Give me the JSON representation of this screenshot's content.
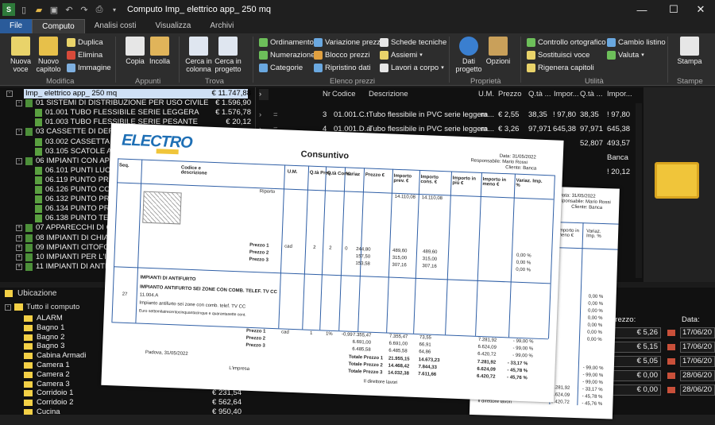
{
  "titlebar": {
    "title": "Computo Imp_ elettrico app_ 250 mq",
    "min": "—",
    "max": "☐",
    "close": "✕"
  },
  "menu": {
    "file": "File",
    "tabs": [
      "Computo",
      "Analisi costi",
      "Visualizza",
      "Archivi"
    ]
  },
  "ribbon": {
    "modifica": {
      "label": "Modifica",
      "nuova_voce": "Nuova voce",
      "nuovo_capitolo": "Nuovo capitolo",
      "duplica": "Duplica",
      "elimina": "Elimina",
      "immagine": "Immagine"
    },
    "appunti": {
      "label": "Appunti",
      "copia": "Copia",
      "incolla": "Incolla"
    },
    "trova": {
      "label": "Trova",
      "cerca_colonna": "Cerca in colonna",
      "cerca_progetto": "Cerca in progetto"
    },
    "elenco": {
      "label": "Elenco prezzi",
      "ordinamento": "Ordinamento",
      "numerazione": "Numerazione",
      "categorie": "Categorie",
      "variazione": "Variazione prezzi",
      "blocco": "Blocco prezzi",
      "ripristino": "Ripristino dati",
      "schede": "Schede tecniche",
      "assiemi": "Assiemi",
      "lavori": "Lavori a corpo"
    },
    "proprieta": {
      "label": "Proprietà",
      "dati_progetto": "Dati progetto",
      "opzioni": "Opzioni"
    },
    "utilita": {
      "label": "Utilità",
      "controllo": "Controllo ortografico",
      "sostituisci": "Sostituisci voce",
      "rigenera": "Rigenera capitoli",
      "cambio": "Cambio listino",
      "valuta": "Valuta"
    },
    "stampe": {
      "label": "Stampe",
      "stampa": "Stampa"
    }
  },
  "tree": [
    {
      "indent": 0,
      "exp": "-",
      "doc": false,
      "text": "Imp_ elettrico app_ 250 mq",
      "amount": "€ 11.747,88",
      "sel": true
    },
    {
      "indent": 1,
      "exp": "-",
      "doc": false,
      "text": "01  SISTEMI DI DISTRIBUZIONE PER USO CIVILE",
      "amount": "€ 1.596,90"
    },
    {
      "indent": 2,
      "exp": "",
      "doc": true,
      "text": "01.001  TUBO FLESSIBILE SERIE LEGGERA",
      "amount": "€ 1.576,78"
    },
    {
      "indent": 2,
      "exp": "",
      "doc": true,
      "text": "01.003  TUBO FLESSIBILE SERIE PESANTE",
      "amount": "€ 20,12"
    },
    {
      "indent": 1,
      "exp": "-",
      "doc": false,
      "text": "03  CASSETTE DI DERIV.C",
      "amount": ""
    },
    {
      "indent": 2,
      "exp": "",
      "doc": true,
      "text": "03.002  CASSETTA DI",
      "amount": ""
    },
    {
      "indent": 2,
      "exp": "",
      "doc": true,
      "text": "03.105  SCATOLE A IN",
      "amount": ""
    },
    {
      "indent": 1,
      "exp": "-",
      "doc": false,
      "text": "06  IMPIANTI CON APPAR",
      "amount": ""
    },
    {
      "indent": 2,
      "exp": "",
      "doc": true,
      "text": "06.101  PUNTI LUCE P",
      "amount": ""
    },
    {
      "indent": 2,
      "exp": "",
      "doc": true,
      "text": "06.119  PUNTO PRESA",
      "amount": ""
    },
    {
      "indent": 2,
      "exp": "",
      "doc": true,
      "text": "06.126  PUNTO CON N",
      "amount": ""
    },
    {
      "indent": 2,
      "exp": "",
      "doc": true,
      "text": "06.132  PUNTO PRESA",
      "amount": ""
    },
    {
      "indent": 2,
      "exp": "",
      "doc": true,
      "text": "06.134  PUNTO PRESA",
      "amount": ""
    },
    {
      "indent": 2,
      "exp": "",
      "doc": true,
      "text": "06.138  PUNTO TERM",
      "amount": ""
    },
    {
      "indent": 1,
      "exp": "+",
      "doc": false,
      "text": "07  APPARECCHI DI COM",
      "amount": ""
    },
    {
      "indent": 1,
      "exp": "+",
      "doc": false,
      "text": "08  IMPIANTI DI CHIAMA",
      "amount": ""
    },
    {
      "indent": 1,
      "exp": "+",
      "doc": false,
      "text": "09  IMPIANTI CITOFONIC",
      "amount": ""
    },
    {
      "indent": 1,
      "exp": "+",
      "doc": false,
      "text": "10  IMPIANTI PER L'ILLUM",
      "amount": ""
    },
    {
      "indent": 1,
      "exp": "+",
      "doc": false,
      "text": "11  IMPIANTI DI ANTIFURT",
      "amount": ""
    }
  ],
  "grid": {
    "headers": [
      "Nr",
      "Codice",
      "Descrizione",
      "U.M.",
      "Prezzo",
      "Q.tà ...",
      "Impor...",
      "Q.tà ...",
      "Impor..."
    ],
    "rows": [
      {
        "nr": "3",
        "code": "01.001.C.t",
        "desc": "Tubo flessibile in PVC serie leggera...",
        "um": "m",
        "price": "€ 2,55",
        "q1": "38,35",
        "i1": "! 97,80",
        "q2": "38,35",
        "i2": "! 97,80"
      },
      {
        "nr": "4",
        "code": "01.001.D.a",
        "desc": "Tubo flessibile in PVC serie leggera...",
        "um": "m",
        "price": "€ 3,26",
        "q1": "97,971",
        "i1": "645,38",
        "q2": "97,971",
        "i2": "645,38"
      },
      {
        "nr": "",
        "code": "",
        "desc": "",
        "um": "",
        "price": "",
        "q1": "52,807",
        "i1": "",
        "q2": "52,807",
        "i2": "493,57"
      },
      {
        "nr": "",
        "code": "",
        "desc": "",
        "um": "",
        "price": "",
        "q1": "",
        "i1": "",
        "q2": "",
        "i2": "Banca"
      },
      {
        "nr": "",
        "code": "",
        "desc": "",
        "um": "",
        "price": "",
        "q1": "4,573",
        "i1": "",
        "q2": "",
        "i2": "! 20,12"
      }
    ]
  },
  "ubicazione": {
    "title": "Ubicazione",
    "root": "Tutto il computo",
    "items": [
      {
        "name": "ALARM",
        "amount": ""
      },
      {
        "name": "Bagno 1",
        "amount": ""
      },
      {
        "name": "Bagno 2",
        "amount": ""
      },
      {
        "name": "Bagno 3",
        "amount": ""
      },
      {
        "name": "Cabina Armadi",
        "amount": ""
      },
      {
        "name": "Camera 1",
        "amount": ""
      },
      {
        "name": "Camera 2",
        "amount": ""
      },
      {
        "name": "Camera 3",
        "amount": ""
      },
      {
        "name": "Corridoio 1",
        "amount": "€ 231,54"
      },
      {
        "name": "Corridoio 2",
        "amount": "€ 562,64"
      },
      {
        "name": "Cucina",
        "amount": "€ 950,40"
      }
    ]
  },
  "prices": {
    "prezzo_label": "Prezzo:",
    "data_label": "Data:",
    "rows": [
      {
        "price": "€ 5,26",
        "date": "17/06/20"
      },
      {
        "price": "€ 5,15",
        "date": "17/06/20"
      },
      {
        "price": "€ 5,05",
        "date": "17/06/20"
      },
      {
        "price": "€ 0,00",
        "date": "28/06/20"
      },
      {
        "price": "€ 0,00",
        "date": "28/06/20"
      }
    ]
  },
  "report": {
    "logo": "ELECTRO",
    "title": "Consuntivo",
    "date": "Data: 31/05/2022",
    "resp": "Responsabile: Mario Rossi",
    "client": "Cliente: Banca",
    "cols": [
      "Seq.",
      "Codice e descrizione",
      "U.M.",
      "Q.tà Prev.",
      "Q.tà Cons.",
      "Variaz",
      "Prezzo €",
      "Importo prev. €",
      "Importo cons. €",
      "Importo in più €",
      "Importo in meno €",
      "Variaz. Imp. %"
    ],
    "riporto": "Riporto",
    "riporto_prev": "14.110,08",
    "riporto_cons": "14.110,08",
    "block1": {
      "labels": [
        "Prezzo 1",
        "Prezzo 2",
        "Prezzo 3"
      ],
      "um": "cad",
      "qp": "2",
      "qc": "2",
      "var": "0",
      "prices": [
        "244,80",
        "157,50",
        "153,58"
      ],
      "prev": [
        "489,60",
        "315,00",
        "307,16"
      ],
      "cons": [
        "489,60",
        "315,00",
        "307,16"
      ],
      "pct": [
        "0,00 %",
        "0,00 %",
        "0,00 %"
      ]
    },
    "item_title": "IMPIANTI DI ANTIFURTO",
    "item_sub": "IMPIANTO ANTIFURTO SEI ZONE CON COMB. TELEF. TV CC",
    "seq": "27",
    "code": "11.004.A",
    "desc1": "Impianto antifurto sei zone con comb. telef. TV CC",
    "desc2": "Euro settemilatrecentocinquantacinque e quarantasette cent.",
    "block2": {
      "labels": [
        "Prezzo 1",
        "Prezzo 2",
        "Prezzo 3"
      ],
      "um": "cad",
      "qp": "1",
      "qc": "1%",
      "var": "-0,99",
      "prices": [
        "7.355,47",
        "6.691,00",
        "6.485,58"
      ],
      "prev": [
        "7.355,47",
        "6.691,00",
        "6.485,58"
      ],
      "cons": [
        "73,55",
        "66,91",
        "64,86"
      ],
      "meno": [
        "7.281,92",
        "6.624,09",
        "6.420,72"
      ],
      "pct": [
        "- 99,00 %",
        "- 99,00 %",
        "- 99,00 %"
      ]
    },
    "totals": [
      {
        "label": "Totale Prezzo 1",
        "prev": "21.955,15",
        "cons": "14.673,23",
        "meno": "7.281,92",
        "pct": "- 33,17 %"
      },
      {
        "label": "Totale Prezzo 2",
        "prev": "14.468,42",
        "cons": "7.844,33",
        "meno": "6.624,09",
        "pct": "- 45,78 %"
      },
      {
        "label": "Totale Prezzo 3",
        "prev": "14.032,38",
        "cons": "7.611,66",
        "meno": "6.420,72",
        "pct": "- 45,76 %"
      }
    ],
    "place": "Padova, 31/05/2022",
    "impresa": "L'impresa",
    "direttore": "Il direttore lavori"
  },
  "report2": {
    "date": "Data: 31/05/2022",
    "resp": "Responsabile: Mario Rossi",
    "client": "Cliente: Banca",
    "cols": [
      "Importo in meno €",
      "Variaz. Imp. %"
    ],
    "pcts": [
      "0,00 %",
      "0,00 %",
      "0,00 %",
      "0,00 %",
      "0,00 %",
      "0,00 %",
      "0,00 %"
    ],
    "bottom": [
      "- 99,00 %",
      "- 99,00 %",
      "- 99,00 %",
      "- 33,17 %",
      "- 45,78 %",
      "- 45,76 %"
    ],
    "left_vals": [
      "7.844,33",
      "7.611,66"
    ],
    "meno": [
      "7.281,92",
      "6.624,09",
      "6.420,72"
    ],
    "direttore": "Il direttore lavori"
  }
}
